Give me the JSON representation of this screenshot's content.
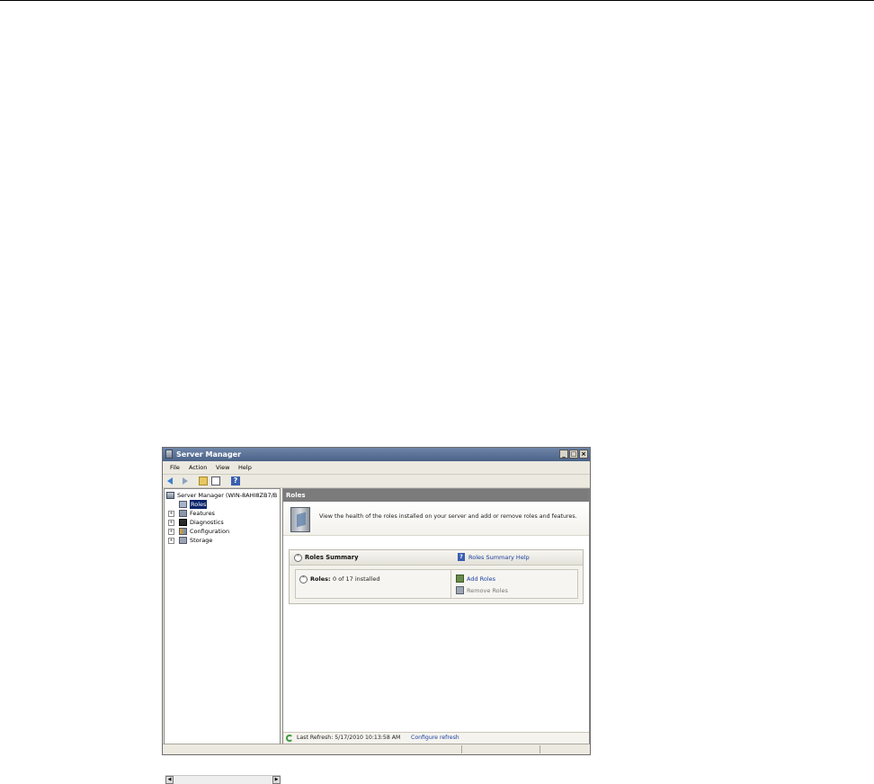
{
  "window": {
    "title": "Server Manager",
    "controls": {
      "minimize": "_",
      "maximize": "□",
      "close": "×"
    }
  },
  "menu": [
    "File",
    "Action",
    "View",
    "Help"
  ],
  "toolbar": {
    "icons": [
      "back-arrow-icon",
      "forward-arrow-icon",
      "up-folder-icon",
      "console-tree-icon",
      "help-icon"
    ],
    "help_glyph": "?"
  },
  "tree": {
    "root": "Server Manager (WIN-8AHI8ZB7/B",
    "items": [
      {
        "label": "Roles",
        "selected": true,
        "expander": ""
      },
      {
        "label": "Features",
        "selected": false,
        "expander": "+"
      },
      {
        "label": "Diagnostics",
        "selected": false,
        "expander": "+"
      },
      {
        "label": "Configuration",
        "selected": false,
        "expander": "+"
      },
      {
        "label": "Storage",
        "selected": false,
        "expander": "+"
      }
    ],
    "scroll_left": "◀",
    "scroll_right": "▶"
  },
  "content": {
    "header": "Roles",
    "intro": "View the health of the roles installed on your server and add or remove roles and features.",
    "summary": {
      "title": "Roles Summary",
      "help_link": "Roles Summary Help",
      "help_glyph": "?",
      "collapse_glyph": "^",
      "roles_label": "Roles:",
      "roles_count": "0 of 17 installed",
      "add_roles": "Add Roles",
      "remove_roles": "Remove Roles"
    },
    "refresh": {
      "text": "Last Refresh: 5/17/2010 10:13:58 AM",
      "link": "Configure refresh"
    }
  },
  "colors": {
    "title_bar": "#4a6288",
    "content_header": "#7b7b7b",
    "link": "#1a3fa0",
    "selection": "#0a246a"
  }
}
